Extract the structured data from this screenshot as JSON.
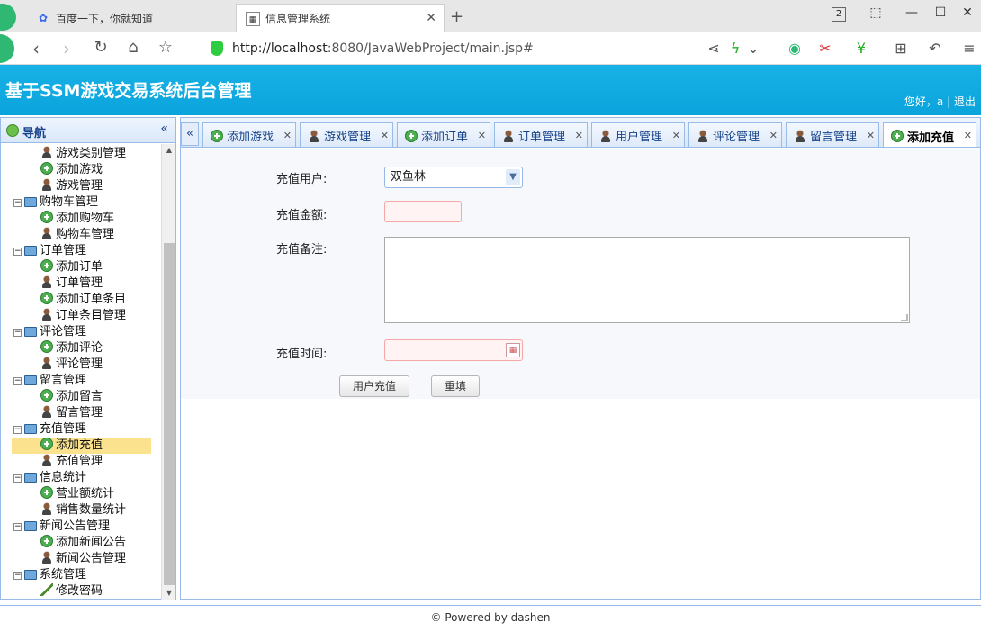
{
  "browser": {
    "tabs": [
      {
        "title": "百度一下，你就知道"
      },
      {
        "title": "信息管理系统"
      }
    ],
    "tab_count_badge": "2",
    "url_host": "http://localhost",
    "url_rest": ":8080/JavaWebProject/main.jsp#"
  },
  "app": {
    "title": "基于SSM游戏交易系统后台管理",
    "greeting": "您好，a",
    "separator": "|",
    "logout": "退出"
  },
  "sidebar": {
    "title": "导航",
    "collapse_glyph": "«",
    "items": [
      {
        "label": "游戏类别管理",
        "level": 2,
        "icon": "user-icon"
      },
      {
        "label": "添加游戏",
        "level": 2,
        "icon": "add-icon"
      },
      {
        "label": "游戏管理",
        "level": 2,
        "icon": "user-icon"
      },
      {
        "label": "购物车管理",
        "level": 1,
        "icon": "computer-icon"
      },
      {
        "label": "添加购物车",
        "level": 2,
        "icon": "add-icon"
      },
      {
        "label": "购物车管理",
        "level": 2,
        "icon": "user-icon"
      },
      {
        "label": "订单管理",
        "level": 1,
        "icon": "computer-icon"
      },
      {
        "label": "添加订单",
        "level": 2,
        "icon": "add-icon"
      },
      {
        "label": "订单管理",
        "level": 2,
        "icon": "user-icon"
      },
      {
        "label": "添加订单条目",
        "level": 2,
        "icon": "add-icon"
      },
      {
        "label": "订单条目管理",
        "level": 2,
        "icon": "user-icon"
      },
      {
        "label": "评论管理",
        "level": 1,
        "icon": "computer-icon"
      },
      {
        "label": "添加评论",
        "level": 2,
        "icon": "add-icon"
      },
      {
        "label": "评论管理",
        "level": 2,
        "icon": "user-icon"
      },
      {
        "label": "留言管理",
        "level": 1,
        "icon": "computer-icon"
      },
      {
        "label": "添加留言",
        "level": 2,
        "icon": "add-icon"
      },
      {
        "label": "留言管理",
        "level": 2,
        "icon": "user-icon"
      },
      {
        "label": "充值管理",
        "level": 1,
        "icon": "computer-icon"
      },
      {
        "label": "添加充值",
        "level": 2,
        "icon": "add-icon",
        "selected": true
      },
      {
        "label": "充值管理",
        "level": 2,
        "icon": "user-icon"
      },
      {
        "label": "信息统计",
        "level": 1,
        "icon": "computer-icon"
      },
      {
        "label": "营业额统计",
        "level": 2,
        "icon": "add-icon"
      },
      {
        "label": "销售数量统计",
        "level": 2,
        "icon": "user-icon"
      },
      {
        "label": "新闻公告管理",
        "level": 1,
        "icon": "computer-icon"
      },
      {
        "label": "添加新闻公告",
        "level": 2,
        "icon": "add-icon"
      },
      {
        "label": "新闻公告管理",
        "level": 2,
        "icon": "user-icon"
      },
      {
        "label": "系统管理",
        "level": 1,
        "icon": "computer-icon"
      },
      {
        "label": "修改密码",
        "level": 2,
        "icon": "pen-icon"
      }
    ]
  },
  "main": {
    "tabs": [
      {
        "label": "添加游戏",
        "icon": "add-icon"
      },
      {
        "label": "游戏管理",
        "icon": "user-icon"
      },
      {
        "label": "添加订单",
        "icon": "add-icon"
      },
      {
        "label": "订单管理",
        "icon": "user-icon"
      },
      {
        "label": "用户管理",
        "icon": "user-icon"
      },
      {
        "label": "评论管理",
        "icon": "user-icon"
      },
      {
        "label": "留言管理",
        "icon": "user-icon"
      },
      {
        "label": "添加充值",
        "icon": "add-icon",
        "active": true
      }
    ],
    "form": {
      "user_label": "充值用户:",
      "user_value": "双鱼林",
      "amount_label": "充值金额:",
      "amount_value": "",
      "remark_label": "充值备注:",
      "remark_value": "",
      "time_label": "充值时间:",
      "time_value": "",
      "submit_label": "用户充值",
      "reset_label": "重填"
    }
  },
  "footer": {
    "text": "© Powered by dashen"
  },
  "colors": {
    "header": "#0aa3dc",
    "panel_border": "#99bbe8",
    "selected_row": "#fbe28f"
  }
}
